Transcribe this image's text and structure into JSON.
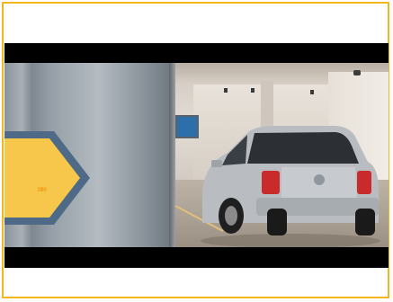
{
  "sign": {
    "chevrons": "»»"
  },
  "colors": {
    "frame_border": "#f5b51c",
    "sign_yellow": "#f6c74a",
    "sign_border": "#4e6a86",
    "letterbox": "#000000"
  },
  "icons": {
    "play_area": "video-frame",
    "sign_arrow": "chevron-right-icon"
  }
}
